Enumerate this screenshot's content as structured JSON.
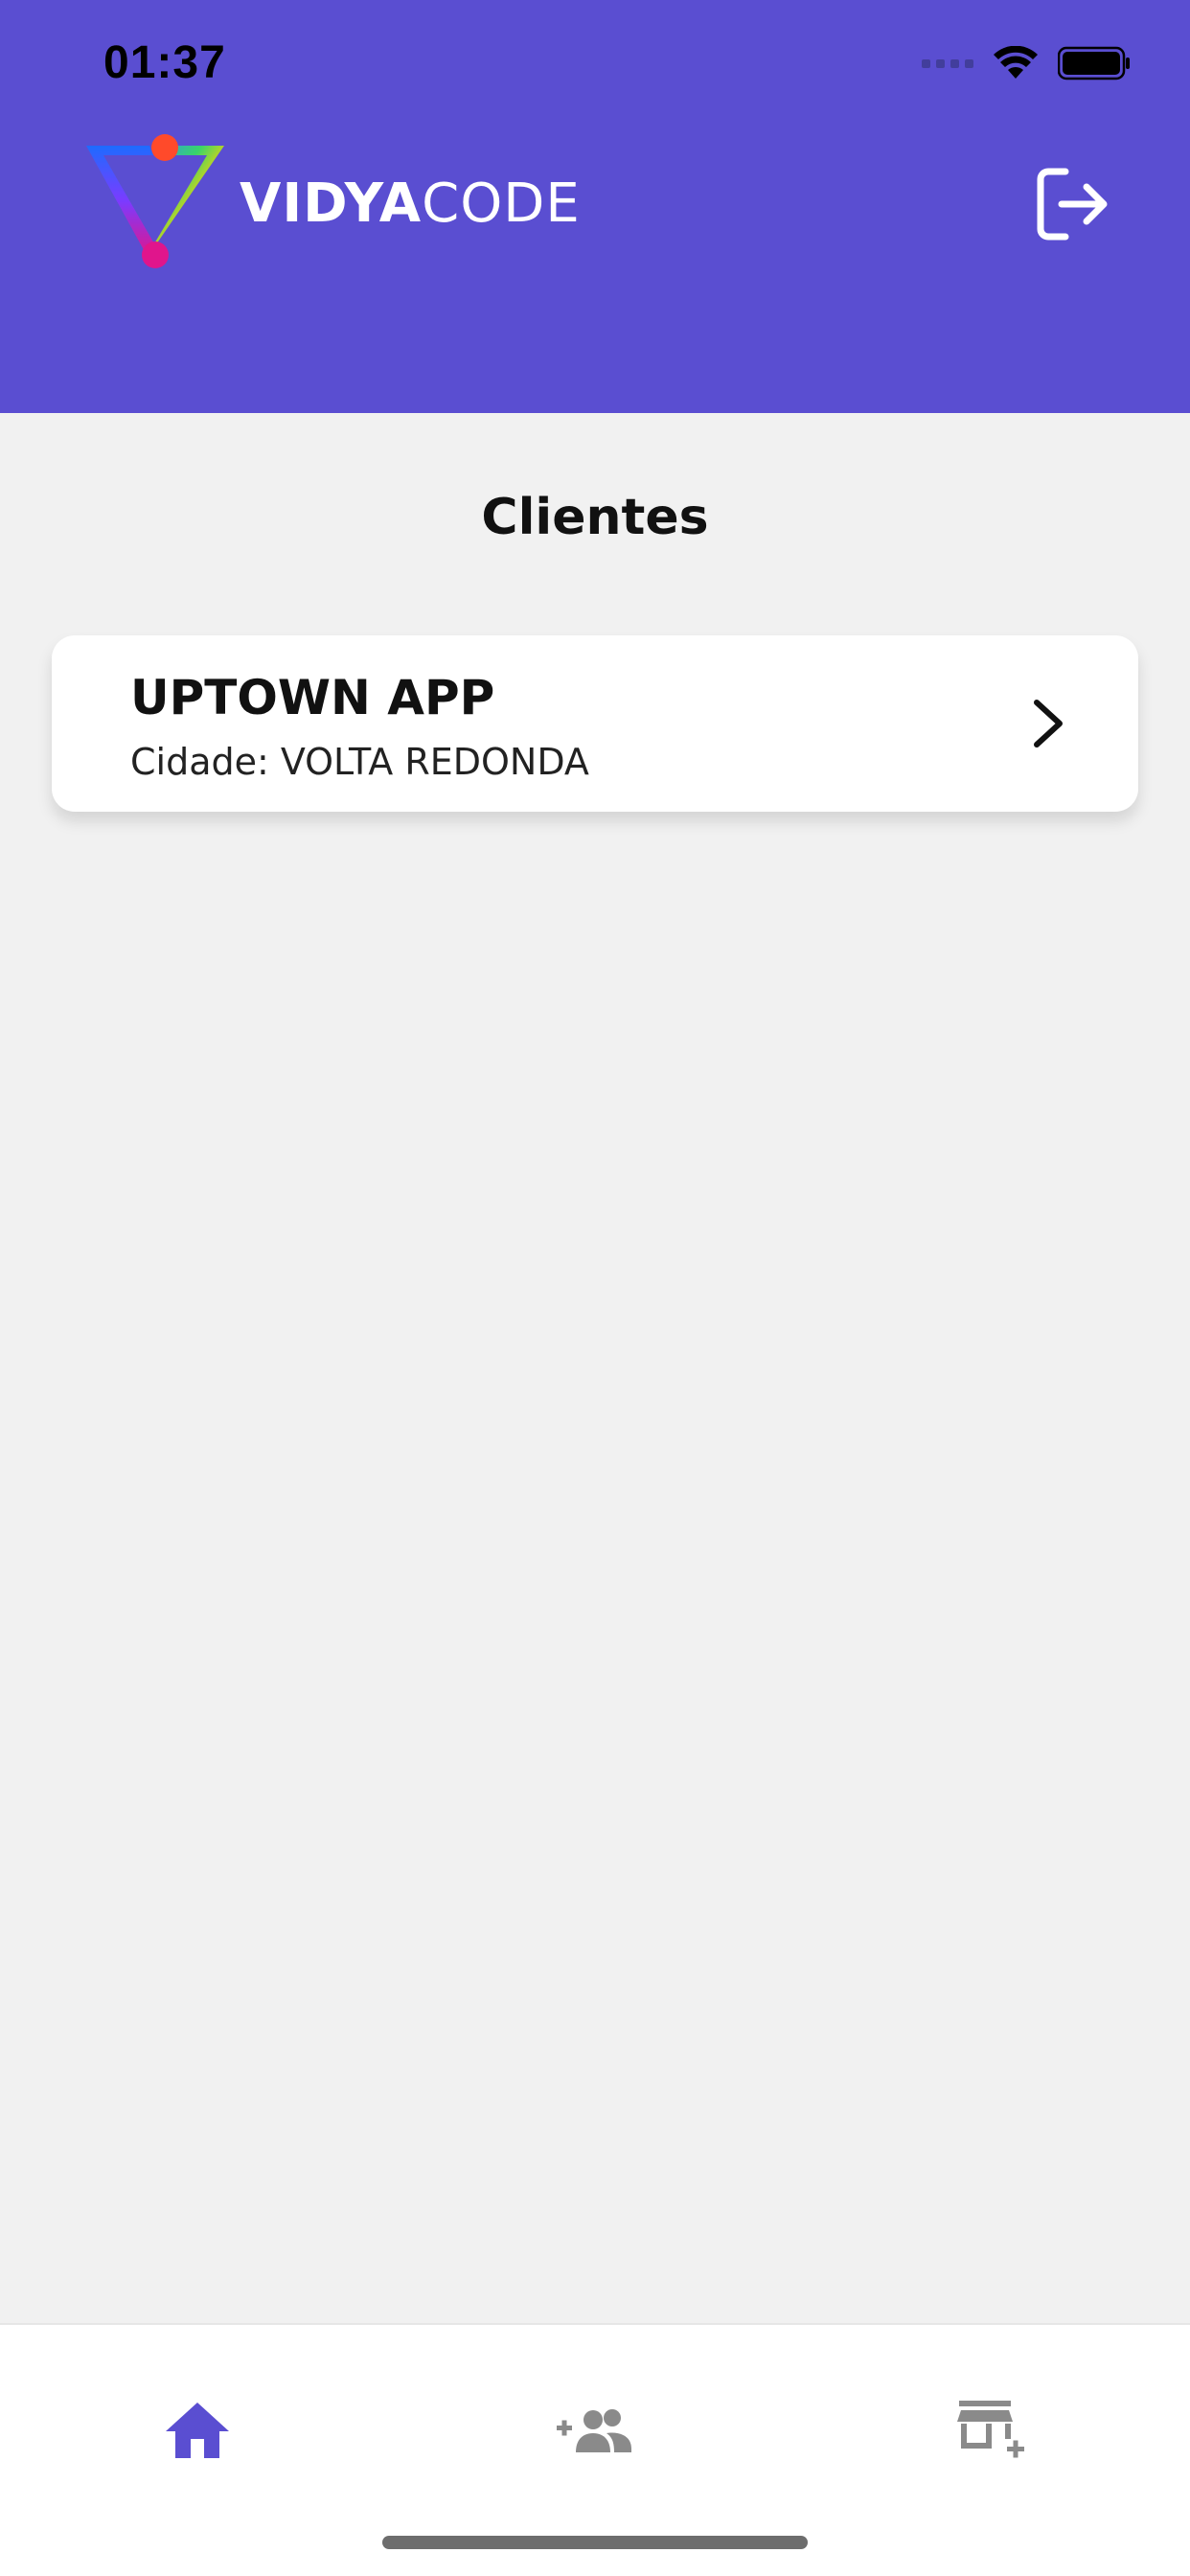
{
  "status_bar": {
    "time": "01:37"
  },
  "header": {
    "logo": {
      "bold": "VIDYA",
      "light": "CODE"
    },
    "logout_icon": "logout-icon",
    "accent_color": "#5a4ed1"
  },
  "main": {
    "title": "Clientes",
    "clients": [
      {
        "name": "UPTOWN APP",
        "city_label": "Cidade:",
        "city": "VOLTA REDONDA"
      }
    ]
  },
  "bottom_nav": {
    "items": [
      {
        "icon": "home-icon",
        "active": true
      },
      {
        "icon": "add-user-group-icon",
        "active": false
      },
      {
        "icon": "add-store-icon",
        "active": false
      }
    ],
    "active_color": "#5a4ed1",
    "inactive_color": "#8a8a8a"
  }
}
